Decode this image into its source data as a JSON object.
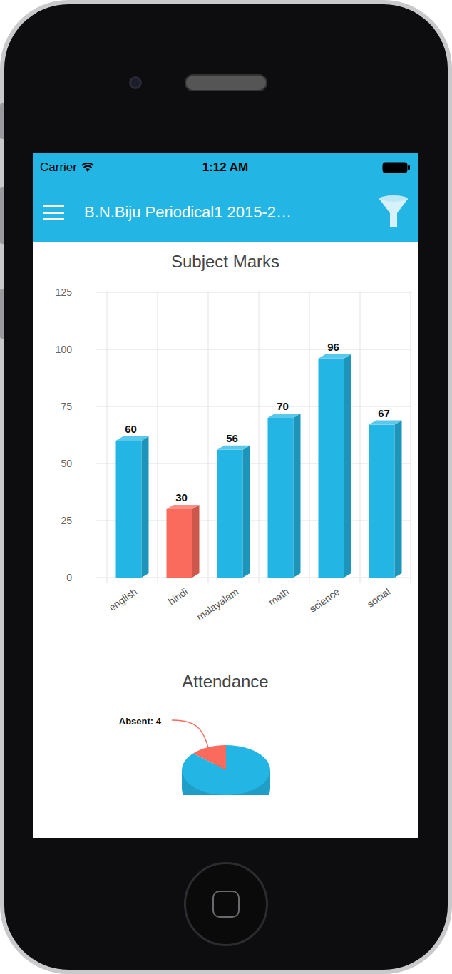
{
  "status_bar": {
    "carrier": "Carrier",
    "time": "1:12 AM"
  },
  "header": {
    "title": "B.N.Biju Periodical1 2015-2…"
  },
  "bar_chart": {
    "title": "Subject Marks",
    "y_ticks": [
      "0",
      "25",
      "50",
      "75",
      "100",
      "125"
    ],
    "categories": [
      "english",
      "hindi",
      "malayalam",
      "math",
      "science",
      "social"
    ],
    "series": [
      {
        "values": [
          60,
          30,
          56,
          70,
          96,
          67
        ],
        "value_labels": [
          "60",
          "30",
          "56",
          "70",
          "96",
          "67"
        ],
        "colors": [
          "#23b5e3",
          "#fa6a5d",
          "#23b5e3",
          "#23b5e3",
          "#23b5e3",
          "#23b5e3"
        ]
      }
    ]
  },
  "pie_chart": {
    "title": "Attendance",
    "slices": [
      {
        "label": "Absent: 4",
        "value": 4,
        "color": "#fa6a5d"
      },
      {
        "value": 26,
        "color": "#23b5e3"
      }
    ]
  }
}
